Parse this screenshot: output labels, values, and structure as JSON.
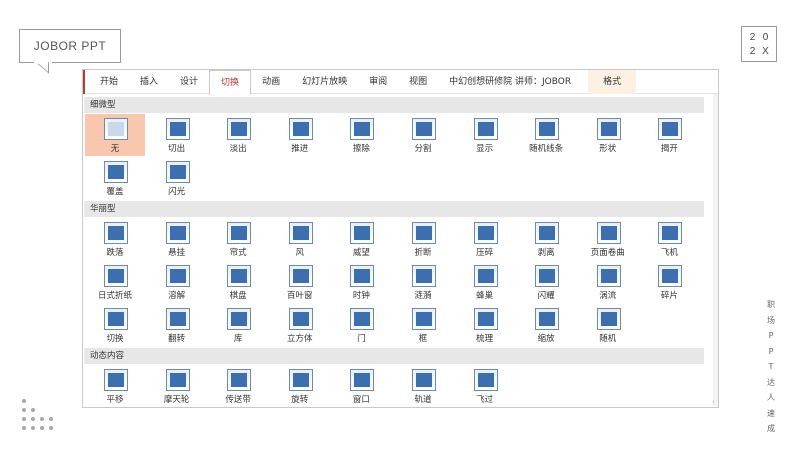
{
  "logo_text": "JOBOR PPT",
  "year": [
    "2",
    "0",
    "2",
    "X"
  ],
  "vertical_text": [
    "职",
    "场",
    "P",
    "P",
    "T",
    "达",
    "人",
    "速",
    "成"
  ],
  "ribbon": {
    "tabs": [
      "开始",
      "插入",
      "设计",
      "切换",
      "动画",
      "幻灯片放映",
      "审阅",
      "视图",
      "中幻创想研修院 讲师：JOBOR",
      "格式"
    ],
    "active_tab": "切换"
  },
  "sections": [
    {
      "title": "细微型",
      "items": [
        {
          "label": "无",
          "icon": "none-transition-icon",
          "selected": true
        },
        {
          "label": "切出",
          "icon": "cut-icon"
        },
        {
          "label": "淡出",
          "icon": "fade-icon"
        },
        {
          "label": "推进",
          "icon": "push-icon"
        },
        {
          "label": "擦除",
          "icon": "wipe-icon"
        },
        {
          "label": "分割",
          "icon": "split-icon"
        },
        {
          "label": "显示",
          "icon": "reveal-icon"
        },
        {
          "label": "随机线条",
          "icon": "random-bars-icon"
        },
        {
          "label": "形状",
          "icon": "shape-icon"
        },
        {
          "label": "揭开",
          "icon": "uncover-icon"
        },
        {
          "label": "覆盖",
          "icon": "cover-icon"
        },
        {
          "label": "闪光",
          "icon": "flash-icon"
        }
      ]
    },
    {
      "title": "华丽型",
      "items": [
        {
          "label": "跌落",
          "icon": "fall-over-icon"
        },
        {
          "label": "悬挂",
          "icon": "drape-icon"
        },
        {
          "label": "帘式",
          "icon": "curtains-icon"
        },
        {
          "label": "风",
          "icon": "wind-icon"
        },
        {
          "label": "威望",
          "icon": "prestige-icon"
        },
        {
          "label": "折断",
          "icon": "fracture-icon"
        },
        {
          "label": "压碎",
          "icon": "crush-icon"
        },
        {
          "label": "剥离",
          "icon": "peel-off-icon"
        },
        {
          "label": "页面卷曲",
          "icon": "page-curl-icon"
        },
        {
          "label": "飞机",
          "icon": "airplane-icon"
        },
        {
          "label": "日式折纸",
          "icon": "origami-icon"
        },
        {
          "label": "溶解",
          "icon": "dissolve-icon"
        },
        {
          "label": "棋盘",
          "icon": "checkerboard-icon"
        },
        {
          "label": "百叶窗",
          "icon": "blinds-icon"
        },
        {
          "label": "时钟",
          "icon": "clock-icon"
        },
        {
          "label": "涟漪",
          "icon": "ripple-icon"
        },
        {
          "label": "蜂巢",
          "icon": "honeycomb-icon"
        },
        {
          "label": "闪耀",
          "icon": "glitter-icon"
        },
        {
          "label": "涡流",
          "icon": "vortex-icon"
        },
        {
          "label": "碎片",
          "icon": "shred-icon"
        },
        {
          "label": "切换",
          "icon": "switch-icon"
        },
        {
          "label": "翻转",
          "icon": "flip-icon"
        },
        {
          "label": "库",
          "icon": "gallery-icon"
        },
        {
          "label": "立方体",
          "icon": "cube-icon"
        },
        {
          "label": "门",
          "icon": "doors-icon"
        },
        {
          "label": "框",
          "icon": "box-icon"
        },
        {
          "label": "梳理",
          "icon": "comb-icon"
        },
        {
          "label": "缩放",
          "icon": "zoom-icon"
        },
        {
          "label": "随机",
          "icon": "random-icon"
        }
      ]
    },
    {
      "title": "动态内容",
      "items": [
        {
          "label": "平移",
          "icon": "pan-icon"
        },
        {
          "label": "摩天轮",
          "icon": "ferris-wheel-icon"
        },
        {
          "label": "传送带",
          "icon": "conveyor-icon"
        },
        {
          "label": "旋转",
          "icon": "rotate-icon"
        },
        {
          "label": "窗口",
          "icon": "window-icon"
        },
        {
          "label": "轨道",
          "icon": "orbit-icon"
        },
        {
          "label": "飞过",
          "icon": "fly-through-icon"
        }
      ]
    }
  ],
  "colors": {
    "accent_red": "#c0392b",
    "icon_blue": "#3c6fb0",
    "selected_bg": "#f9c7ad",
    "section_bg": "#e7e7e7",
    "format_tab_bg": "#fdf1e3"
  }
}
